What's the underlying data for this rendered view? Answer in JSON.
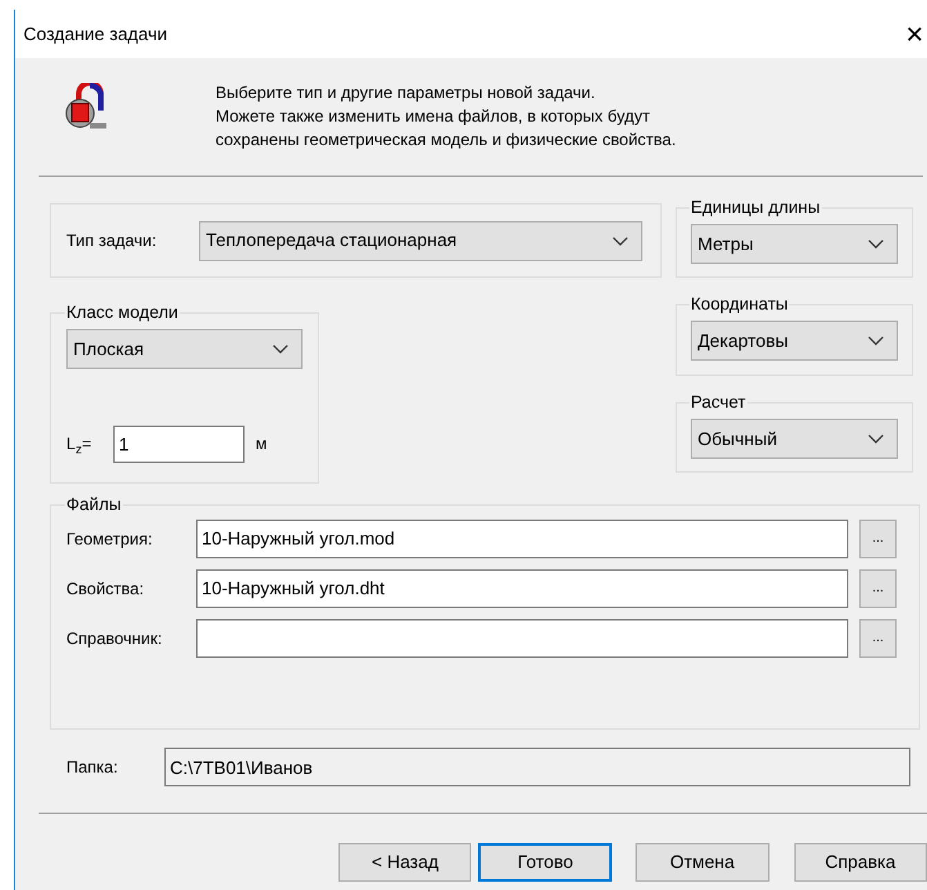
{
  "window": {
    "title": "Создание задачи",
    "close": "×"
  },
  "header": {
    "lines": [
      "Выберите тип и другие параметры новой задачи.",
      "Можете также изменить имена файлов, в которых будут",
      "сохранены геометрическая модель и физические свойства."
    ]
  },
  "task_type": {
    "label": "Тип задачи:",
    "value": "Теплопередача стационарная"
  },
  "length_units": {
    "legend": "Единицы длины",
    "value": "Метры"
  },
  "model_class": {
    "legend": "Класс модели",
    "value": "Плоская",
    "lz": {
      "label": "L$_{z}$=",
      "value": "1",
      "unit": "м"
    }
  },
  "coordinates": {
    "legend": "Координаты",
    "value": "Декартовы"
  },
  "calculation": {
    "legend": "Расчет",
    "value": "Обычный"
  },
  "files": {
    "legend": "Файлы",
    "rows": [
      {
        "label": "Геометрия:",
        "value": "10-Наружный угол.mod",
        "browse": "..."
      },
      {
        "label": "Свойства:",
        "value": "10-Наружный угол.dht",
        "browse": "..."
      },
      {
        "label": "Справочник:",
        "browse": "..."
      }
    ]
  },
  "folder": {
    "label": "Папка:",
    "value": "C:\\7TB01\\Иванов"
  },
  "buttons": [
    {
      "label": "< Назад",
      "default": false
    },
    {
      "label": "Готово",
      "default": true
    },
    {
      "label": "Отмена",
      "default": false
    },
    {
      "label": "Справка",
      "default": false
    }
  ]
}
